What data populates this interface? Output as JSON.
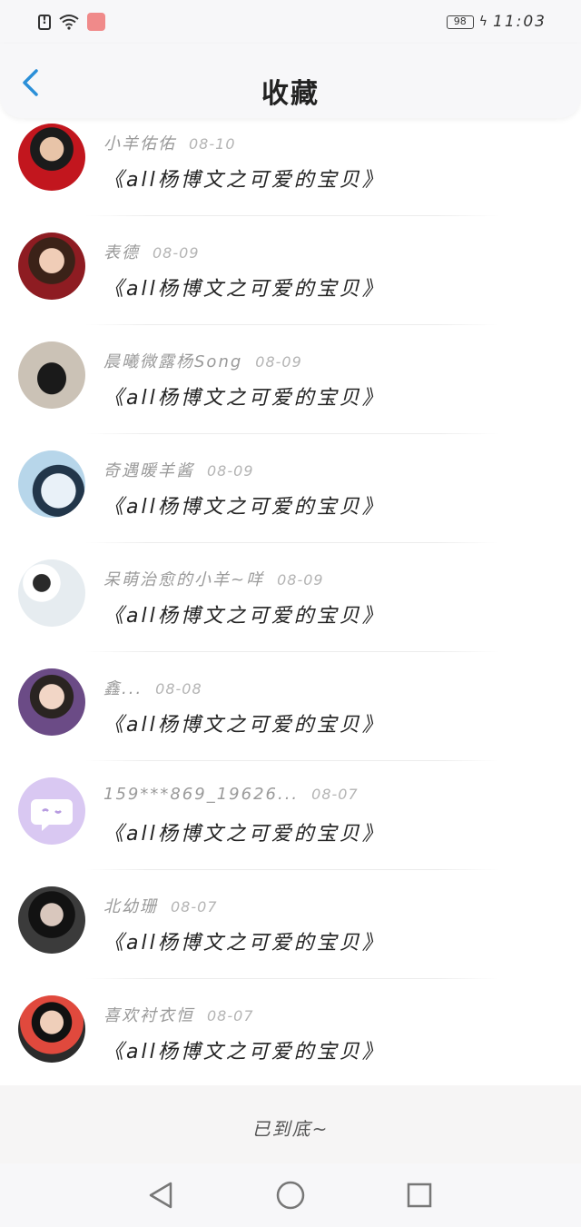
{
  "status_bar": {
    "battery": "98",
    "time": "11:03"
  },
  "header": {
    "title": "收藏"
  },
  "accent_color": "#2b8fd8",
  "favorites": [
    {
      "user": "小羊佑佑",
      "date": "08-10",
      "title": "《all杨博文之可爱的宝贝》",
      "avatar": "person-red"
    },
    {
      "user": "表德",
      "date": "08-09",
      "title": "《all杨博文之可爱的宝贝》",
      "avatar": "person-girl"
    },
    {
      "user": "晨曦微露杨Song",
      "date": "08-09",
      "title": "《all杨博文之可爱的宝贝》",
      "avatar": "silhouette"
    },
    {
      "user": "奇遇暖羊酱",
      "date": "08-09",
      "title": "《all杨博文之可爱的宝贝》",
      "avatar": "hug"
    },
    {
      "user": "呆萌治愈的小羊~咩",
      "date": "08-09",
      "title": "《all杨博文之可爱的宝贝》",
      "avatar": "duo"
    },
    {
      "user": "鑫...",
      "date": "08-08",
      "title": "《all杨博文之可爱的宝贝》",
      "avatar": "person-smile"
    },
    {
      "user": "159***869_19626...",
      "date": "08-07",
      "title": "《all杨博文之可爱的宝贝》",
      "avatar": "default-chat"
    },
    {
      "user": "北幼珊",
      "date": "08-07",
      "title": "《all杨博文之可爱的宝贝》",
      "avatar": "person-dark"
    },
    {
      "user": "喜欢衬衣恒",
      "date": "08-07",
      "title": "《all杨博文之可爱的宝贝》",
      "avatar": "person-heart"
    }
  ],
  "footer": {
    "end_text": "已到底~"
  },
  "nav": {
    "back": "back-triangle-icon",
    "home": "home-circle-icon",
    "recent": "recent-square-icon"
  }
}
